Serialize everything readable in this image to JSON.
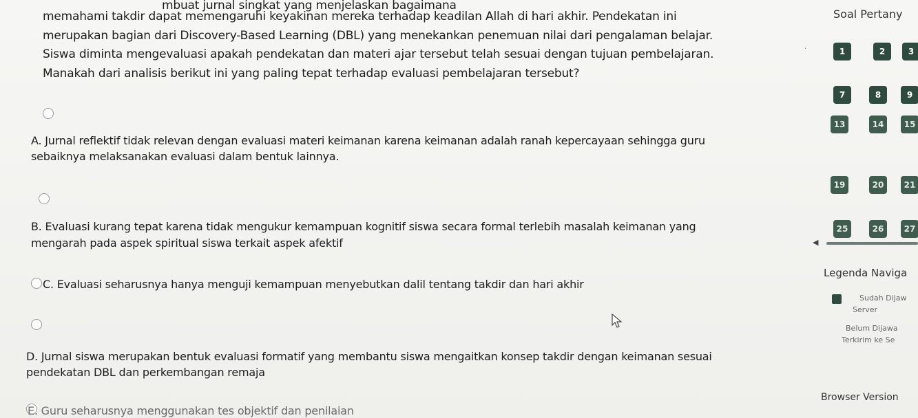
{
  "question": {
    "lines": [
      "mbuat jurnal singkat yang menjelaskan bagaimana",
      "memahami takdir dapat memengaruhi keyakinan mereka terhadap keadilan Allah di hari akhir. Pendekatan ini",
      "merupakan bagian dari Discovery-Based Learning (DBL) yang menekankan penemuan nilai dari pengalaman belajar.",
      "Siswa diminta mengevaluasi apakah pendekatan dan materi ajar tersebut telah sesuai dengan tujuan pembelajaran.",
      "Manakah dari analisis berikut ini yang paling tepat terhadap evaluasi pembelajaran tersebut?"
    ]
  },
  "options": [
    {
      "lines": [
        "A. Jurnal reflektif tidak relevan dengan evaluasi materi keimanan karena keimanan adalah ranah kepercayaan sehingga guru",
        "sebaiknya melaksanakan evaluasi dalam bentuk lainnya."
      ]
    },
    {
      "lines": [
        "B. Evaluasi kurang tepat karena tidak mengukur kemampuan kognitif siswa secara formal terlebih masalah keimanan yang",
        "mengarah pada aspek spiritual siswa terkait aspek afektif"
      ]
    },
    {
      "lines": [
        "C. Evaluasi seharusnya hanya menguji kemampuan menyebutkan dalil tentang takdir dan hari akhir"
      ]
    },
    {
      "lines": [
        "D. Jurnal siswa merupakan bentuk evaluasi formatif yang membantu siswa mengaitkan konsep takdir dengan keimanan sesuai",
        "pendekatan DBL dan perkembangan remaja"
      ]
    },
    {
      "lines": [
        "E. Guru seharusnya menggunakan tes objektif dan penilaian"
      ]
    }
  ],
  "sidebar": {
    "title": "Soal Pertany",
    "numbers": [
      "1",
      "2",
      "3",
      "7",
      "8",
      "9",
      "13",
      "14",
      "15",
      "19",
      "20",
      "21",
      "25",
      "26",
      "27"
    ],
    "legend_title": "Legenda Naviga",
    "legend_saved_line1": "Sudah Dijaw",
    "legend_saved_line2": "Server",
    "legend_unsaved_line1": "Belum Dijawa",
    "legend_unsaved_line2": "Terkirim ke Se",
    "browser_version": "Browser Version",
    "nav_prev_icon": "chevron-left-icon",
    "colors": {
      "answered": "#2f4a3e",
      "accent": "#3f5c4e"
    }
  }
}
